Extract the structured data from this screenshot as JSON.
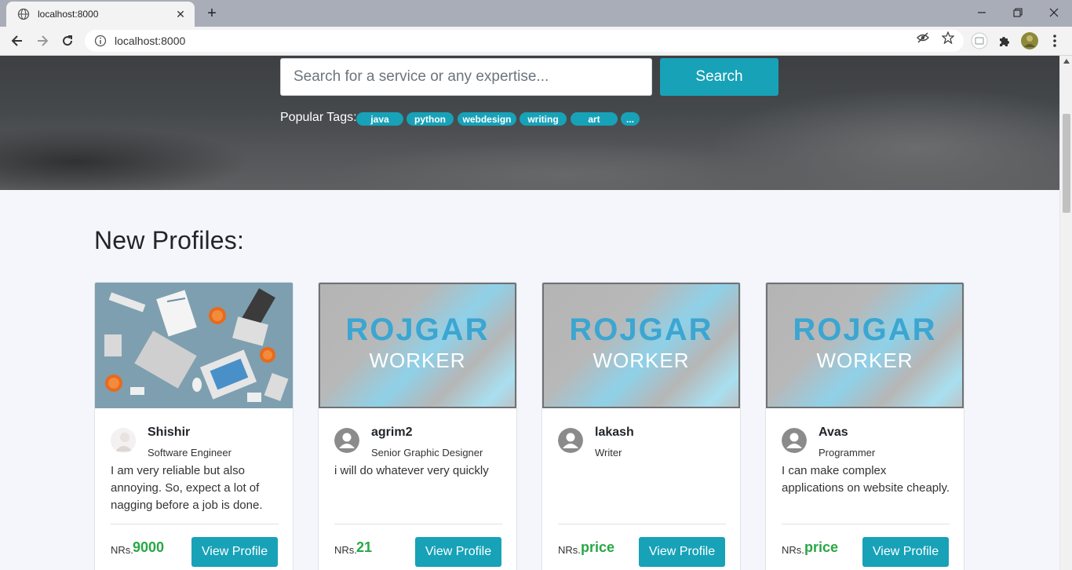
{
  "browser": {
    "tab_title": "localhost:8000",
    "url": "localhost:8000"
  },
  "search": {
    "placeholder": "Search for a service or any expertise...",
    "button_label": "Search"
  },
  "popular_tags": {
    "label": "Popular Tags:",
    "tags": [
      "java",
      "python",
      "webdesign",
      "writing",
      "art",
      "..."
    ]
  },
  "section_title": "New Profiles:",
  "profiles": [
    {
      "name": "Shishir",
      "role": "Software Engineer",
      "description": "I am very reliable but also annoying. So, expect a lot of nagging before a job is done.",
      "price_label": "NRs.",
      "price": "9000",
      "button": "View Profile",
      "image": "workspace-illustration"
    },
    {
      "name": "agrim2",
      "role": "Senior Graphic Designer",
      "description": "i will do whatever very quickly",
      "price_label": "NRs.",
      "price": "21",
      "button": "View Profile",
      "image": "rojgar-worker-logo"
    },
    {
      "name": "lakash",
      "role": "Writer",
      "description": "",
      "price_label": "NRs.",
      "price": "price",
      "button": "View Profile",
      "image": "rojgar-worker-logo"
    },
    {
      "name": "Avas",
      "role": "Programmer",
      "description": "I can make complex applications on website cheaply.",
      "price_label": "NRs.",
      "price": "price",
      "button": "View Profile",
      "image": "rojgar-worker-logo"
    }
  ],
  "logo": {
    "line1": "ROJGAR",
    "line2": "WORKER"
  },
  "colors": {
    "accent": "#17a2b8",
    "price": "#28a745",
    "logo_blue": "#3ba6d1"
  }
}
